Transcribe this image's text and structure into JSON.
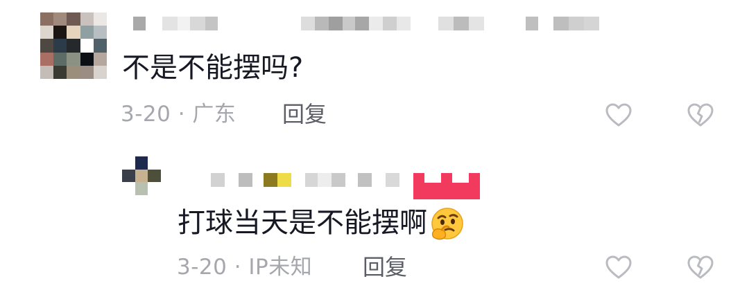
{
  "comments": [
    {
      "text": "不是不能摆吗?",
      "date_location": "3-20 · 广东",
      "reply_label": "回复",
      "avatar_pixels": [
        "#8a6f62",
        "#a08a7e",
        "#6e5a52",
        "#c9c1bd",
        "#ebe7e5",
        "#dcd6cf",
        "#1b1614",
        "#e7d4bc",
        "#8ea0a1",
        "#b7bfc2",
        "#4e4843",
        "#2b3b47",
        "#26292b",
        "#ffffff",
        "#51616a",
        "#a96f65",
        "#5d6c66",
        "#8b9183",
        "#0c0f13",
        "#b6a79e",
        "#c4bcb7",
        "#3a3a32",
        "#9b8e7a",
        "#9c8d84",
        "#d9d3cf"
      ],
      "name_blocks": [
        {
          "w": 18,
          "c": "#a9a9a9"
        },
        {
          "w": 24,
          "c": "#ffffff"
        },
        {
          "w": 22,
          "c": "#e3e3e3"
        },
        {
          "w": 18,
          "c": "#f2f2f2"
        },
        {
          "w": 22,
          "c": "#d8d8d8"
        },
        {
          "w": 18,
          "c": "#c4c4c4"
        },
        {
          "w": 120,
          "c": "#ffffff"
        },
        {
          "w": 20,
          "c": "#dddddd"
        },
        {
          "w": 20,
          "c": "#b9b9b9"
        },
        {
          "w": 20,
          "c": "#9f9f9f"
        },
        {
          "w": 18,
          "c": "#c9c9c9"
        },
        {
          "w": 20,
          "c": "#a7a7a7"
        },
        {
          "w": 20,
          "c": "#ebebeb"
        },
        {
          "w": 20,
          "c": "#cfcfcf"
        },
        {
          "w": 20,
          "c": "#e8e8e8"
        },
        {
          "w": 40,
          "c": "#ffffff"
        },
        {
          "w": 22,
          "c": "#e0e0e0"
        },
        {
          "w": 22,
          "c": "#bcbcbc"
        },
        {
          "w": 22,
          "c": "#e4e4e4"
        },
        {
          "w": 60,
          "c": "#ffffff"
        },
        {
          "w": 18,
          "c": "#bfbfbf"
        },
        {
          "w": 22,
          "c": "#ffffff"
        },
        {
          "w": 22,
          "c": "#bebebe"
        },
        {
          "w": 22,
          "c": "#cfcfcf"
        },
        {
          "w": 22,
          "c": "#d5d5d5"
        }
      ]
    },
    {
      "text": "打球当天是不能摆啊",
      "date_location": "3-20 · IP未知",
      "reply_label": "回复",
      "avatar_pixels": [
        "#ffffff",
        "#1d2a4e",
        "#ffffff",
        "#3b3f4a",
        "#c6b290",
        "#4d4f3b",
        "#ffffff",
        "#b8c0b0",
        "#ffffff"
      ],
      "name_blocks": [
        {
          "w": 60,
          "c": "#ffffff"
        },
        {
          "w": 20,
          "c": "#d2d2d2"
        },
        {
          "w": 20,
          "c": "#ffffff"
        },
        {
          "w": 20,
          "c": "#bdbdbd"
        },
        {
          "w": 16,
          "c": "#ffffff"
        },
        {
          "w": 20,
          "c": "#8c7a20"
        },
        {
          "w": 20,
          "c": "#eedb48"
        },
        {
          "w": 20,
          "c": "#ffffff"
        },
        {
          "w": 18,
          "c": "#d6d6d6"
        },
        {
          "w": 20,
          "c": "#ededed"
        },
        {
          "w": 20,
          "c": "#c9c9c9"
        },
        {
          "w": 18,
          "c": "#ffffff"
        },
        {
          "w": 20,
          "c": "#c1c1c1"
        },
        {
          "w": 20,
          "c": "#ffffff"
        },
        {
          "w": 20,
          "c": "#d9d9d9"
        }
      ]
    }
  ],
  "icons": {
    "like": "heart-outline-icon",
    "dislike": "broken-heart-outline-icon",
    "emoji": "thinking-face-emoji-icon"
  },
  "colors": {
    "text_primary": "#161823",
    "text_meta": "#a5a7ad",
    "reply": "#5c5e67",
    "icon": "#b9bbc0",
    "badge": "#f23a5e"
  }
}
